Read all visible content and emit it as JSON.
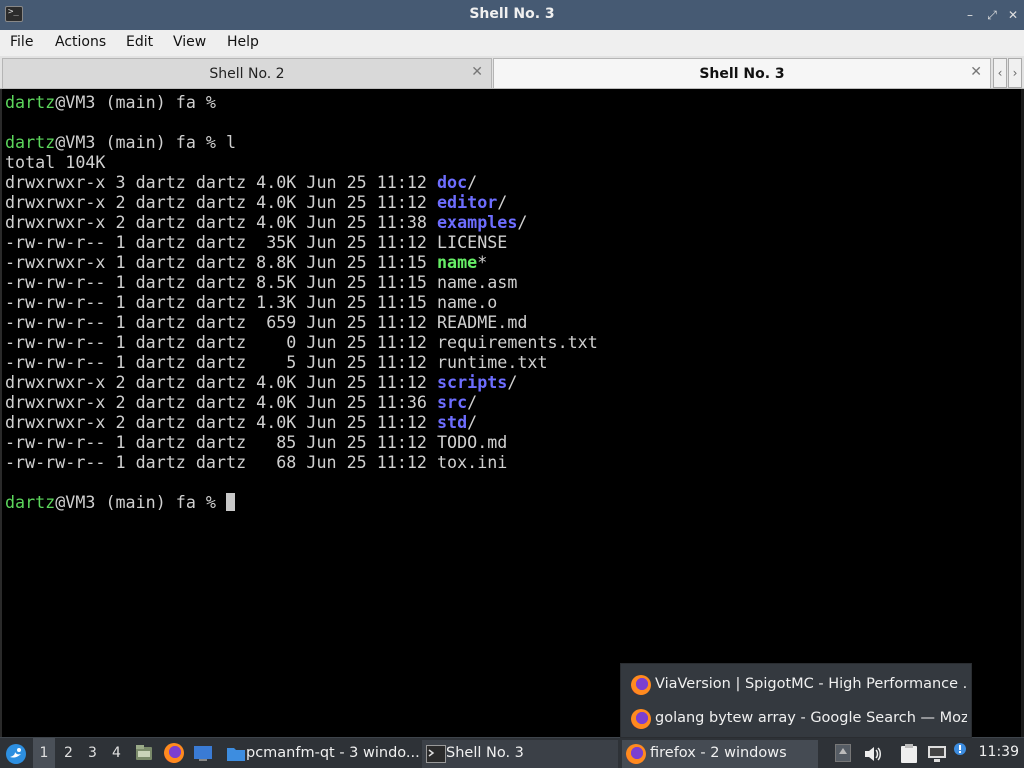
{
  "window": {
    "title": "Shell No. 3",
    "app_icon_glyph": ">_",
    "icon": "terminal-icon"
  },
  "menu": [
    "File",
    "Actions",
    "Edit",
    "View",
    "Help"
  ],
  "tabs": [
    {
      "label": "Shell No. 2",
      "active": false
    },
    {
      "label": "Shell No. 3",
      "active": true
    }
  ],
  "terminal": {
    "colors": {
      "prompt_user": "#5cd65c",
      "directory": "#6d6dff",
      "executable": "#66ee66",
      "text": "#d0d0d0"
    },
    "prompt_user": "dartz",
    "prompt_rest": "@VM3 (main) fa %",
    "command": " l",
    "total": "total 104K",
    "listing": [
      {
        "meta": "drwxrwxr-x 3 dartz dartz 4.0K Jun 25 11:12 ",
        "name": "doc",
        "suffix": "/",
        "kind": "dir"
      },
      {
        "meta": "drwxrwxr-x 2 dartz dartz 4.0K Jun 25 11:12 ",
        "name": "editor",
        "suffix": "/",
        "kind": "dir"
      },
      {
        "meta": "drwxrwxr-x 2 dartz dartz 4.0K Jun 25 11:38 ",
        "name": "examples",
        "suffix": "/",
        "kind": "dir"
      },
      {
        "meta": "-rw-rw-r-- 1 dartz dartz  35K Jun 25 11:12 ",
        "name": "LICENSE",
        "suffix": "",
        "kind": "file"
      },
      {
        "meta": "-rwxrwxr-x 1 dartz dartz 8.8K Jun 25 11:15 ",
        "name": "name",
        "suffix": "*",
        "kind": "exec"
      },
      {
        "meta": "-rw-rw-r-- 1 dartz dartz 8.5K Jun 25 11:15 ",
        "name": "name.asm",
        "suffix": "",
        "kind": "file"
      },
      {
        "meta": "-rw-rw-r-- 1 dartz dartz 1.3K Jun 25 11:15 ",
        "name": "name.o",
        "suffix": "",
        "kind": "file"
      },
      {
        "meta": "-rw-rw-r-- 1 dartz dartz  659 Jun 25 11:12 ",
        "name": "README.md",
        "suffix": "",
        "kind": "file"
      },
      {
        "meta": "-rw-rw-r-- 1 dartz dartz    0 Jun 25 11:12 ",
        "name": "requirements.txt",
        "suffix": "",
        "kind": "file"
      },
      {
        "meta": "-rw-rw-r-- 1 dartz dartz    5 Jun 25 11:12 ",
        "name": "runtime.txt",
        "suffix": "",
        "kind": "file"
      },
      {
        "meta": "drwxrwxr-x 2 dartz dartz 4.0K Jun 25 11:12 ",
        "name": "scripts",
        "suffix": "/",
        "kind": "dir"
      },
      {
        "meta": "drwxrwxr-x 2 dartz dartz 4.0K Jun 25 11:36 ",
        "name": "src",
        "suffix": "/",
        "kind": "dir"
      },
      {
        "meta": "drwxrwxr-x 2 dartz dartz 4.0K Jun 25 11:12 ",
        "name": "std",
        "suffix": "/",
        "kind": "dir"
      },
      {
        "meta": "-rw-rw-r-- 1 dartz dartz   85 Jun 25 11:12 ",
        "name": "TODO.md",
        "suffix": "",
        "kind": "file"
      },
      {
        "meta": "-rw-rw-r-- 1 dartz dartz   68 Jun 25 11:12 ",
        "name": "tox.ini",
        "suffix": "",
        "kind": "file"
      }
    ]
  },
  "popup": {
    "items": [
      {
        "label": "ViaVersion | SpigotMC - High Performance ..."
      },
      {
        "label": "golang bytew array - Google Search — Mozi..."
      }
    ]
  },
  "taskbar": {
    "desktops": [
      "1",
      "2",
      "3",
      "4"
    ],
    "current_desktop": "1",
    "tasks": [
      {
        "label": "pcmanfm-qt - 3 windo...",
        "icon": "folder-icon"
      },
      {
        "label": "Shell No. 3",
        "icon": "terminal-icon"
      },
      {
        "label": "firefox - 2 windows",
        "icon": "firefox-icon"
      }
    ],
    "clock": "11:39",
    "colors": {
      "bg": "#2e3237",
      "title_bar": "#465a73"
    }
  }
}
